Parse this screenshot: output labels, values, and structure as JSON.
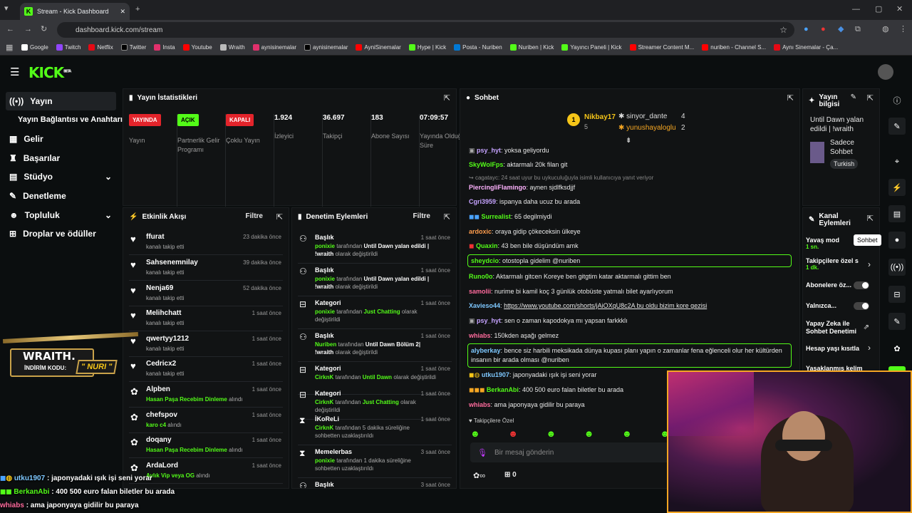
{
  "browser": {
    "tab_title": "Stream - Kick Dashboard",
    "url": "dashboard.kick.com/stream",
    "bookmarks": [
      "Google",
      "Twitch",
      "Netflix",
      "Twitter",
      "Insta",
      "Youtube",
      "Wraith",
      "aynisinemalar",
      "aynisinemalar",
      "AyniSinemalar",
      "Hype | Kick",
      "Posta - Nuriben",
      "Nuriben | Kick",
      "Yayıncı Paneli | Kick",
      "Streamer Content M...",
      "nuriben - Channel S...",
      "Aynı Sinemalar - Ça..."
    ]
  },
  "logo": "KICK",
  "logo_badge": "BETA",
  "sidebar": {
    "items": [
      "Yayın",
      "Yayın Bağlantısı ve Anahtarı",
      "Gelir",
      "Başarılar",
      "Stüdyo",
      "Denetleme",
      "Topluluk",
      "Droplar ve ödüller"
    ]
  },
  "stats": {
    "title": "Yayın İstatistikleri",
    "items": [
      {
        "badge": "YAYINDA",
        "label": "Yayın"
      },
      {
        "badge": "AÇIK",
        "label": "Partnerlik Gelir Programı"
      },
      {
        "badge": "KAPALI",
        "label": "Çoklu Yayın"
      },
      {
        "value": "1.924",
        "label": "İzleyici"
      },
      {
        "value": "36.697",
        "label": "Takipçi"
      },
      {
        "value": "183",
        "label": "Abone Sayısı"
      },
      {
        "value": "07:09:57",
        "label": "Yayında Olduğu Süre"
      }
    ]
  },
  "activity": {
    "title": "Etkinlik Akışı",
    "filter": "Filtre",
    "events": [
      {
        "name": "ffurat",
        "sub": "kanalı takip etti",
        "time": "23 dakika önce"
      },
      {
        "name": "Sahsenemnilay",
        "sub": "kanalı takip etti",
        "time": "39 dakika önce"
      },
      {
        "name": "Nenja69",
        "sub": "kanalı takip etti",
        "time": "52 dakika önce"
      },
      {
        "name": "Melihchatt",
        "sub": "kanalı takip etti",
        "time": "1 saat önce"
      },
      {
        "name": "qwertyy1212",
        "sub": "kanalı takip etti",
        "time": "1 saat önce"
      },
      {
        "name": "Cedricx2",
        "sub": "kanalı takip etti",
        "time": "1 saat önce"
      },
      {
        "name": "Alpben",
        "reward": "Hasan Paşa Recebim Dinleme",
        "sub": "alındı",
        "time": "1 saat önce"
      },
      {
        "name": "chefspov",
        "reward": "karo c4",
        "sub": "alındı",
        "time": "1 saat önce"
      },
      {
        "name": "doqany",
        "reward": "Hasan Paşa Recebim Dinleme",
        "sub": "alındı",
        "time": "1 saat önce"
      },
      {
        "name": "ArdaLord",
        "reward": "Aylık Vip veya OG",
        "sub": "alındı",
        "time": "1 saat önce"
      }
    ]
  },
  "moderation": {
    "title": "Denetim Eylemleri",
    "filter": "Filtre",
    "actions": [
      {
        "title": "Başlık",
        "actor": "ponixie",
        "mid": "tarafından",
        "target": "Until Dawn yalan edildi | !wraith",
        "end": "olarak değiştirildi",
        "time": "1 saat önce"
      },
      {
        "title": "Başlık",
        "actor": "ponixie",
        "mid": "tarafından",
        "target": "Until Dawn yalan edildi | !wraith",
        "end": "olarak değiştirildi",
        "time": "1 saat önce"
      },
      {
        "title": "Kategori",
        "actor": "ponixie",
        "mid": "tarafından",
        "target": "Just Chatting",
        "end": "olarak değiştirildi",
        "time": "1 saat önce"
      },
      {
        "title": "Başlık",
        "actor": "Nuriben",
        "mid": "tarafından",
        "target": "Until Dawn Bölüm 2| !wraith",
        "end": "olarak değiştirildi",
        "time": "1 saat önce"
      },
      {
        "title": "Kategori",
        "actor": "CirknK",
        "mid": "tarafından",
        "target": "Until Dawn",
        "end": "olarak değiştirildi",
        "time": "1 saat önce"
      },
      {
        "title": "Kategori",
        "actor": "CirknK",
        "mid": "tarafından",
        "target": "Just Chatting",
        "end": "olarak değiştirildi",
        "time": "1 saat önce"
      },
      {
        "title": "İKoReLi",
        "actor": "CirknK",
        "mid": "tarafından 5 dakika süreliğine sohbetten uzaklaştırıldı",
        "target": "",
        "end": "",
        "time": "1 saat önce"
      },
      {
        "title": "Memelerbas",
        "actor": "ponixie",
        "mid": "tarafından 1 dakika süreliğine sohbetten uzaklaştırıldı",
        "target": "",
        "end": "",
        "time": "3 saat önce"
      },
      {
        "title": "Başlık",
        "actor": "",
        "mid": "",
        "target": "",
        "end": "",
        "time": "3 saat önce"
      }
    ]
  },
  "chat": {
    "title": "Sohbet",
    "top_gifters": [
      {
        "name": "Nikbay17",
        "count": "5"
      },
      {
        "name": "sinyor_dante",
        "count": "4"
      },
      {
        "name": "yunushayaloglu",
        "count": "2"
      }
    ],
    "messages": [
      {
        "user": "psy_hyt",
        "color": "#c6a3ff",
        "text": "yoksa geliyordu"
      },
      {
        "user": "SkyWolFps",
        "color": "#53fc18",
        "text": "aktarmalı 20k filan git"
      },
      {
        "reply": "cagatayc: 24 saat uyur bu uykuculuğuyla isimli kullanıcıya yanıt veriyor"
      },
      {
        "user": "PiercingliFlamingo",
        "color": "#ffb3ff",
        "text": "aynen sjdlfksdjjf"
      },
      {
        "user": "Cgri3959",
        "color": "#c6a3ff",
        "text": "ispanya daha ucuz bu arada"
      },
      {
        "user": "Surrealist",
        "color": "#53fc18",
        "text": "65 degilmiydi"
      },
      {
        "user": "ardoxic",
        "color": "#ff9d4d",
        "text": "oraya gidip çökeceksin ülkeye"
      },
      {
        "user": "Quaxin",
        "color": "#53fc18",
        "text": "43 ben bile düşündüm amk"
      },
      {
        "user": "sheydcio",
        "color": "#53fc18",
        "text": "otostopla gidelim @nuriben",
        "highlight": true
      },
      {
        "user": "Runo0o",
        "color": "#53fc18",
        "text": "Aktarmalı gitcen Koreye ben gitgtim katar aktarmalı gittim ben"
      },
      {
        "user": "samolii",
        "color": "#ff6b9d",
        "text": "nurime bi kamil koç 3 günlük otobüste yatmalı bilet ayarlıyorum"
      },
      {
        "user": "Xavieso44",
        "color": "#7ec8ff",
        "text": "https://www.youtube.com/shorts/jAiOXqU8c2A bu oldu bizim kore gezisi"
      },
      {
        "user": "psy_hyt",
        "color": "#c6a3ff",
        "text": "sen o zaman kapodokya mı yapsan farkkklı"
      },
      {
        "user": "whiabs",
        "color": "#ff6b9d",
        "text": "150kden aşağı gelmez"
      },
      {
        "user": "alyberkay",
        "color": "#7ec8ff",
        "text": "bence siz harbili meksikada dünya kupası planı yapın o zamanlar fena eğlenceli olur her kültürden insanın bir arada olması @nuriben",
        "highlight": true
      },
      {
        "user": "utku1907",
        "color": "#7ec8ff",
        "text": "japonyadaki ışık işi seni yorar"
      },
      {
        "user": "BerkanAbi",
        "color": "#53fc18",
        "text": "400 500 euro falan biletler bu arada"
      },
      {
        "user": "whiabs",
        "color": "#ff6b9d",
        "text": "ama japonyaya gidilir bu paraya"
      }
    ],
    "followers_only": "Takipçilere Özel",
    "input_placeholder": "Bir mesaj gönderin",
    "footer_count": "0"
  },
  "stream_info": {
    "title": "Yayın bilgisi",
    "stream_title": "Until Dawn yalan edildi | !wraith",
    "category": "Sadece Sohbet",
    "language": "Turkish"
  },
  "channel_actions": {
    "title": "Kanal Eylemleri",
    "items": [
      {
        "label": "Yavaş mod",
        "sub": "1 sn."
      },
      {
        "label": "Takipçilere özel s",
        "sub": "1 dk."
      },
      {
        "label": "Abonelere öz..."
      },
      {
        "label": "Yalnızca..."
      },
      {
        "label": "Yapay Zeka ile Sohbet Denetimi"
      },
      {
        "label": "Hesap yaşı kısıtla"
      },
      {
        "label": "Yasaklanmış kelim"
      }
    ]
  },
  "tooltip": "Sohbet",
  "overlay": {
    "brand": "WRAITH.",
    "code_label": "İNDİRİM KODU:",
    "code": "\" NURI \"",
    "chat": [
      {
        "user": "utku1907",
        "text": ": japonyadaki ışık işi seni yorar"
      },
      {
        "user": "BerkanAbi",
        "text": ": 400 500 euro falan biletler bu arada"
      },
      {
        "user": "whiabs",
        "text": ": ama japonyaya gidilir bu paraya"
      }
    ]
  }
}
